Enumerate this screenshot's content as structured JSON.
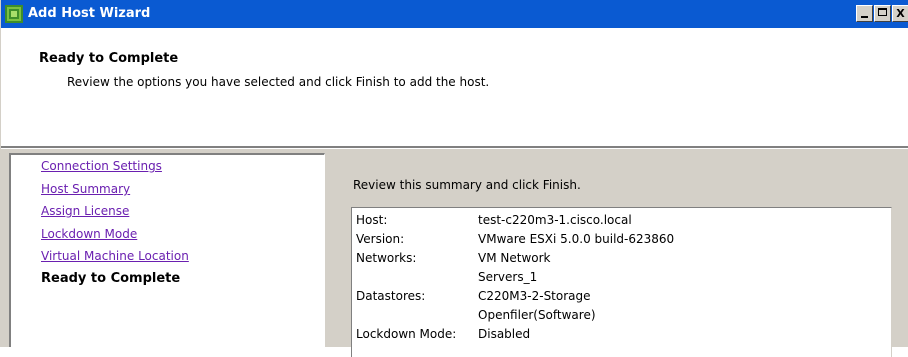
{
  "window": {
    "title": "Add Host Wizard",
    "title_icon": "vsphere-wizard-icon",
    "controls": {
      "minimize": "_",
      "maximize": "□",
      "close": "X"
    },
    "colors": {
      "titlebar": "#0a5ad2",
      "link": "#6a1fb0",
      "panel": "#d4d0c8"
    }
  },
  "header": {
    "title": "Ready to Complete",
    "subtitle": "Review the options you have selected and click Finish to add the host."
  },
  "nav": {
    "items": [
      {
        "label": "Connection Settings",
        "current": false
      },
      {
        "label": "Host Summary",
        "current": false
      },
      {
        "label": "Assign License",
        "current": false
      },
      {
        "label": "Lockdown Mode",
        "current": false
      },
      {
        "label": "Virtual Machine Location",
        "current": false
      },
      {
        "label": "Ready to Complete",
        "current": true
      }
    ]
  },
  "summary": {
    "intro": "Review this summary and click Finish.",
    "rows": [
      {
        "key": "Host:",
        "value": "test-c220m3-1.cisco.local"
      },
      {
        "key": "Version:",
        "value": "VMware ESXi 5.0.0 build-623860"
      },
      {
        "key": "Networks:",
        "value": "VM Network"
      },
      {
        "key": "",
        "value": "Servers_1"
      },
      {
        "key": "Datastores:",
        "value": "C220M3-2-Storage"
      },
      {
        "key": "",
        "value": "Openfiler(Software)"
      },
      {
        "key": "Lockdown Mode:",
        "value": "Disabled"
      }
    ]
  }
}
